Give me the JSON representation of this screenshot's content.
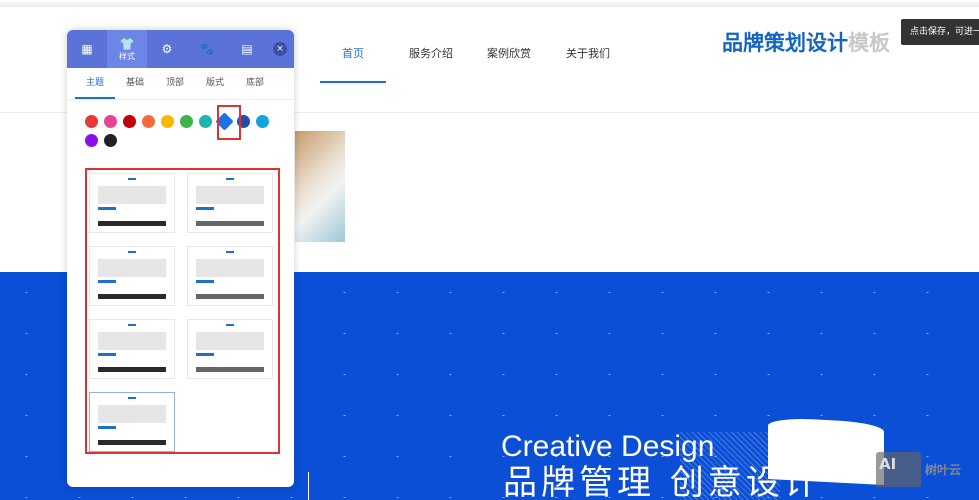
{
  "header": {
    "nav": [
      "首页",
      "服务介绍",
      "案例欣赏",
      "关于我们"
    ],
    "brand_main": "品牌策划设计",
    "brand_suffix": "模板",
    "tooltip": "点击保存，可进一"
  },
  "hero": {
    "title_en": "Creative Design",
    "title_cn": "品牌管理 创意设计"
  },
  "watermark": {
    "logo": "AI",
    "text": "树叶云"
  },
  "panel": {
    "top_tabs": [
      {
        "icon": "grid-icon"
      },
      {
        "icon": "shirt-icon",
        "label": "样式"
      },
      {
        "icon": "gear-icon"
      },
      {
        "icon": "paw-icon"
      },
      {
        "icon": "building-icon"
      }
    ],
    "close": "×",
    "sub_tabs": [
      "主题",
      "基础",
      "顶部",
      "版式",
      "底部"
    ],
    "colors": [
      "#e53935",
      "#e84393",
      "#c0000c",
      "#f26b38",
      "#f9b800",
      "#3bb54a",
      "#1fb5ad",
      "#1a73e8",
      "#1f4fa8",
      "#10a5e0",
      "#8b10e8",
      "#222222"
    ],
    "selected_color": "#1a73e8",
    "templates": 7,
    "selected_template": 7
  }
}
